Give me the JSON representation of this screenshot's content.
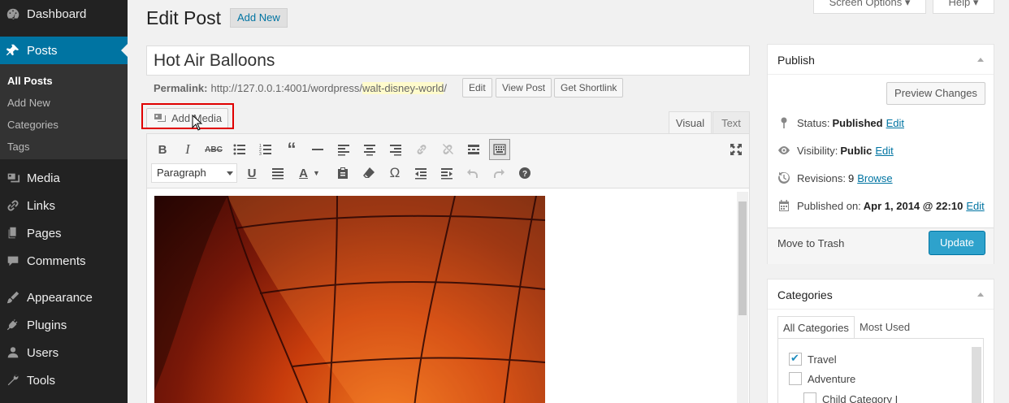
{
  "sidebar": {
    "items": [
      {
        "label": "Dashboard",
        "icon": "dashboard-icon"
      },
      {
        "label": "Posts",
        "icon": "pin-icon",
        "active": true
      },
      {
        "label": "Media",
        "icon": "media-icon"
      },
      {
        "label": "Links",
        "icon": "link-icon"
      },
      {
        "label": "Pages",
        "icon": "page-icon"
      },
      {
        "label": "Comments",
        "icon": "comment-icon"
      },
      {
        "label": "Appearance",
        "icon": "paintbrush-icon"
      },
      {
        "label": "Plugins",
        "icon": "plug-icon"
      },
      {
        "label": "Users",
        "icon": "user-icon"
      },
      {
        "label": "Tools",
        "icon": "wrench-icon"
      }
    ],
    "submenu": [
      "All Posts",
      "Add New",
      "Categories",
      "Tags"
    ]
  },
  "header": {
    "title": "Edit Post",
    "add_new": "Add New",
    "screen_options": "Screen Options",
    "help": "Help"
  },
  "post": {
    "title": "Hot Air Balloons",
    "permalink_label": "Permalink:",
    "permalink_base": "http://127.0.0.1:4001/wordpress/",
    "permalink_slug": "walt-disney-world",
    "permalink_trail": "/",
    "edit_btn": "Edit",
    "view_btn": "View Post",
    "shortlink_btn": "Get Shortlink"
  },
  "editor": {
    "add_media": "Add Media",
    "tab_visual": "Visual",
    "tab_text": "Text",
    "format": "Paragraph",
    "accent_color": "#e00000"
  },
  "publish": {
    "title": "Publish",
    "preview": "Preview Changes",
    "status_label": "Status:",
    "status_value": "Published",
    "visibility_label": "Visibility:",
    "visibility_value": "Public",
    "revisions_label": "Revisions:",
    "revisions_value": "9",
    "browse": "Browse",
    "published_label": "Published on:",
    "published_value": "Apr 1, 2014 @ 22:10",
    "edit": "Edit",
    "trash": "Move to Trash",
    "update": "Update"
  },
  "categories": {
    "title": "Categories",
    "tab_all": "All Categories",
    "tab_most": "Most Used",
    "items": [
      {
        "label": "Travel",
        "checked": true
      },
      {
        "label": "Adventure",
        "checked": false
      },
      {
        "label": "Child Category I",
        "checked": false
      }
    ]
  }
}
